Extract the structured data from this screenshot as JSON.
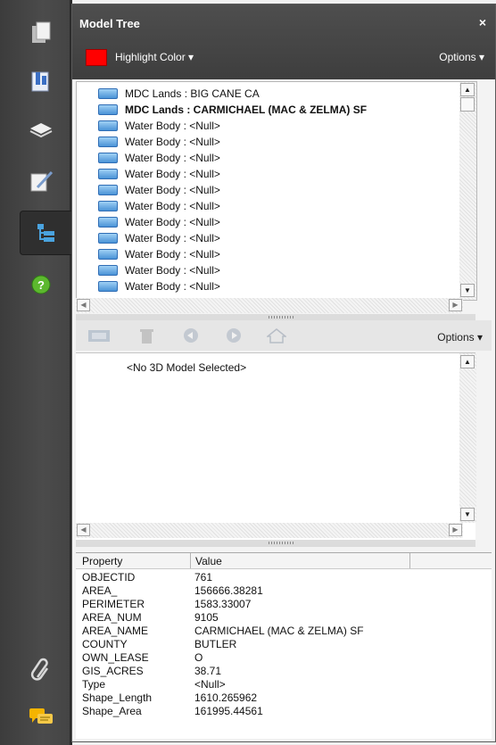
{
  "panel": {
    "title": "Model Tree",
    "close": "×",
    "highlight_label": "Highlight Color ▾",
    "highlight_color": "#ff0000",
    "options_top": "Options ▾"
  },
  "tree": {
    "items": [
      {
        "label": "MDC Lands : BIG CANE CA",
        "bold": false
      },
      {
        "label": "MDC Lands : CARMICHAEL (MAC & ZELMA) SF",
        "bold": true
      },
      {
        "label": "Water Body : <Null>",
        "bold": false
      },
      {
        "label": "Water Body : <Null>",
        "bold": false
      },
      {
        "label": "Water Body : <Null>",
        "bold": false
      },
      {
        "label": "Water Body : <Null>",
        "bold": false
      },
      {
        "label": "Water Body : <Null>",
        "bold": false
      },
      {
        "label": "Water Body : <Null>",
        "bold": false
      },
      {
        "label": "Water Body : <Null>",
        "bold": false
      },
      {
        "label": "Water Body : <Null>",
        "bold": false
      },
      {
        "label": "Water Body : <Null>",
        "bold": false
      },
      {
        "label": "Water Body : <Null>",
        "bold": false
      },
      {
        "label": "Water Body : <Null>",
        "bold": false
      }
    ]
  },
  "toolbar": {
    "options_label": "Options ▾"
  },
  "model": {
    "empty_message": "<No 3D Model Selected>"
  },
  "properties": {
    "header_property": "Property",
    "header_value": "Value",
    "rows": [
      {
        "key": "OBJECTID",
        "value": "761"
      },
      {
        "key": "AREA_",
        "value": "156666.38281"
      },
      {
        "key": "PERIMETER",
        "value": "1583.33007"
      },
      {
        "key": "AREA_NUM",
        "value": "9105"
      },
      {
        "key": "AREA_NAME",
        "value": "CARMICHAEL (MAC & ZELMA) SF"
      },
      {
        "key": "COUNTY",
        "value": "BUTLER"
      },
      {
        "key": "OWN_LEASE",
        "value": "O"
      },
      {
        "key": "GIS_ACRES",
        "value": "38.71"
      },
      {
        "key": "Type",
        "value": "<Null>"
      },
      {
        "key": "Shape_Length",
        "value": "1610.265962"
      },
      {
        "key": "Shape_Area",
        "value": "161995.44561"
      }
    ]
  }
}
